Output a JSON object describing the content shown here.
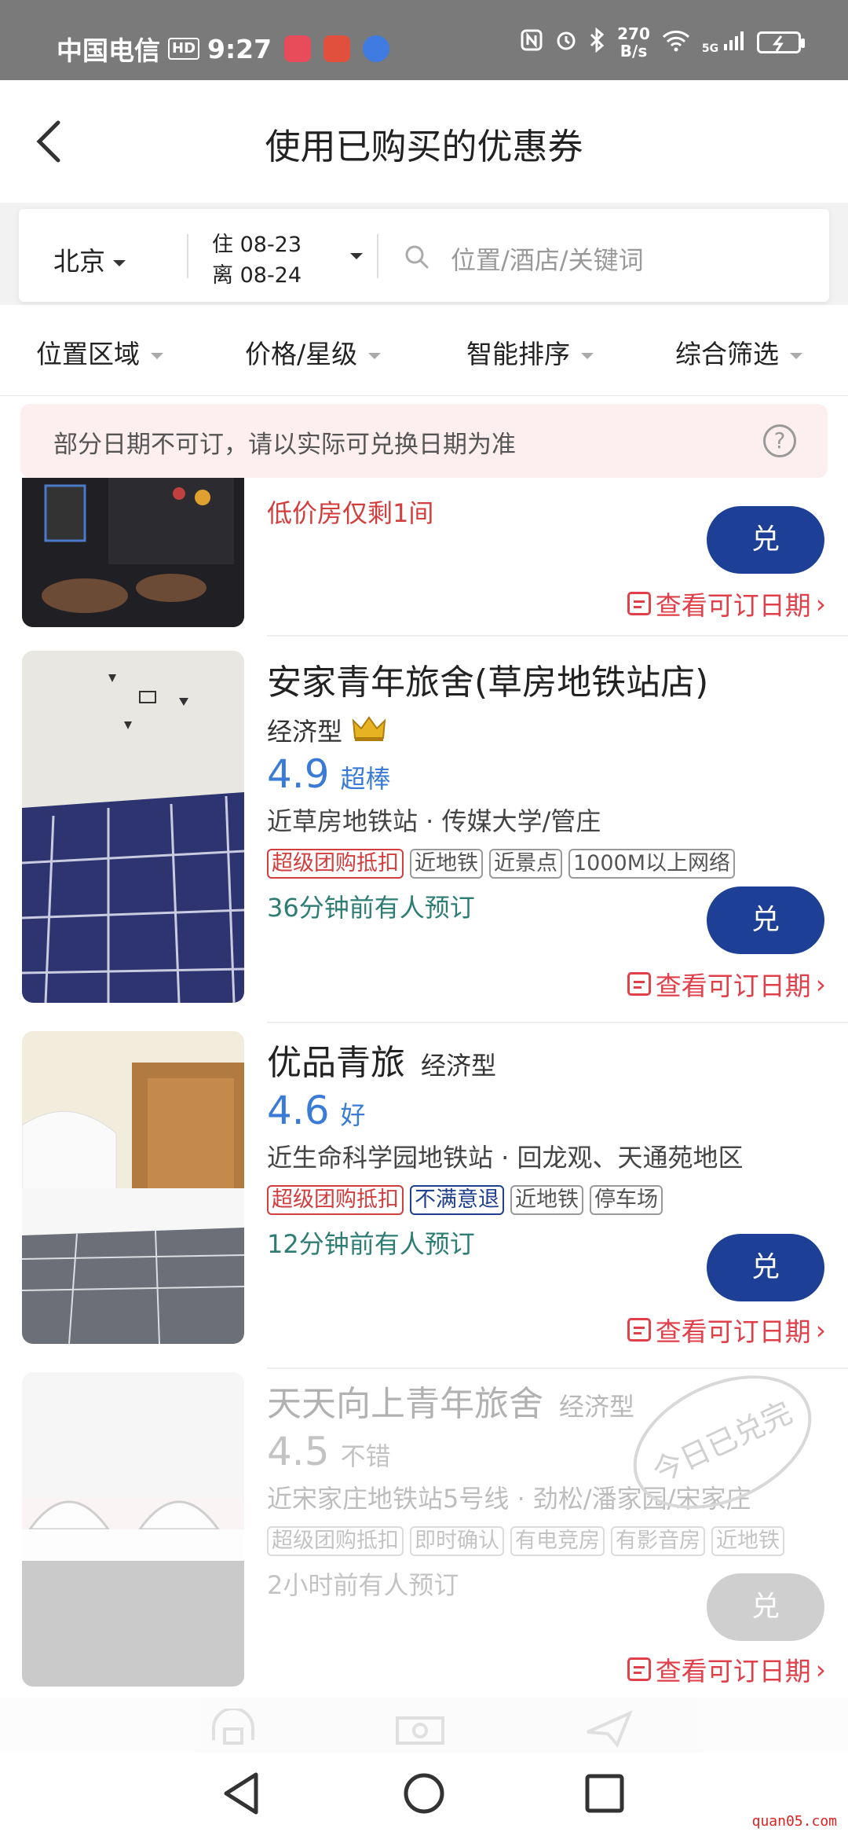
{
  "status_bar": {
    "carrier": "中国电信",
    "hd": "HD",
    "time": "9:27",
    "speed_value": "270",
    "speed_unit": "B/s",
    "network": "5G"
  },
  "header": {
    "title": "使用已购买的优惠券"
  },
  "search": {
    "city": "北京",
    "checkin": "住 08-23",
    "checkout": "离 08-24",
    "placeholder": "位置/酒店/关键词"
  },
  "filters": [
    {
      "label": "位置区域"
    },
    {
      "label": "价格/星级"
    },
    {
      "label": "智能排序"
    },
    {
      "label": "综合筛选"
    }
  ],
  "notice": {
    "text": "部分日期不可订，请以实际可兑换日期为准",
    "help": "?"
  },
  "redeem_label": "兑",
  "calendar_label": "查看可订日期",
  "partial_item": {
    "urgency": "低价房仅剩1间"
  },
  "hotels": [
    {
      "name": "安家青年旅舍(草房地铁站店)",
      "star_type": "经济型",
      "rating": "4.9",
      "rating_word": "超棒",
      "location": "近草房地铁站 · 传媒大学/管庄",
      "tags": [
        {
          "text": "超级团购抵扣",
          "style": "red"
        },
        {
          "text": "近地铁",
          "style": "gray"
        },
        {
          "text": "近景点",
          "style": "gray"
        },
        {
          "text": "1000M以上网络",
          "style": "gray"
        }
      ],
      "booked": "36分钟前有人预订",
      "available": true
    },
    {
      "name": "优品青旅",
      "star_type": "经济型",
      "rating": "4.6",
      "rating_word": "好",
      "location": "近生命科学园地铁站 · 回龙观、天通苑地区",
      "tags": [
        {
          "text": "超级团购抵扣",
          "style": "red"
        },
        {
          "text": "不满意退",
          "style": "blue"
        },
        {
          "text": "近地铁",
          "style": "gray"
        },
        {
          "text": "停车场",
          "style": "gray"
        }
      ],
      "booked": "12分钟前有人预订",
      "available": true
    },
    {
      "name": "天天向上青年旅舍",
      "star_type": "经济型",
      "rating": "4.5",
      "rating_word": "不错",
      "location": "近宋家庄地铁站5号线 · 劲松/潘家园/宋家庄",
      "tags": [
        {
          "text": "超级团购抵扣",
          "style": "gray"
        },
        {
          "text": "即时确认",
          "style": "gray"
        },
        {
          "text": "有电竞房",
          "style": "gray"
        },
        {
          "text": "有影音房",
          "style": "gray"
        },
        {
          "text": "近地铁",
          "style": "gray"
        }
      ],
      "booked": "2小时前有人预订",
      "available": false
    }
  ],
  "sold_out_stamp": "今日已兑完",
  "watermark": "quan05.com",
  "colors": {
    "accent_blue": "#1d3f96",
    "rating_blue": "#3a7bd5",
    "tag_red": "#d23d3d",
    "link_red": "#e0404a",
    "booked_green": "#2e7d74"
  }
}
